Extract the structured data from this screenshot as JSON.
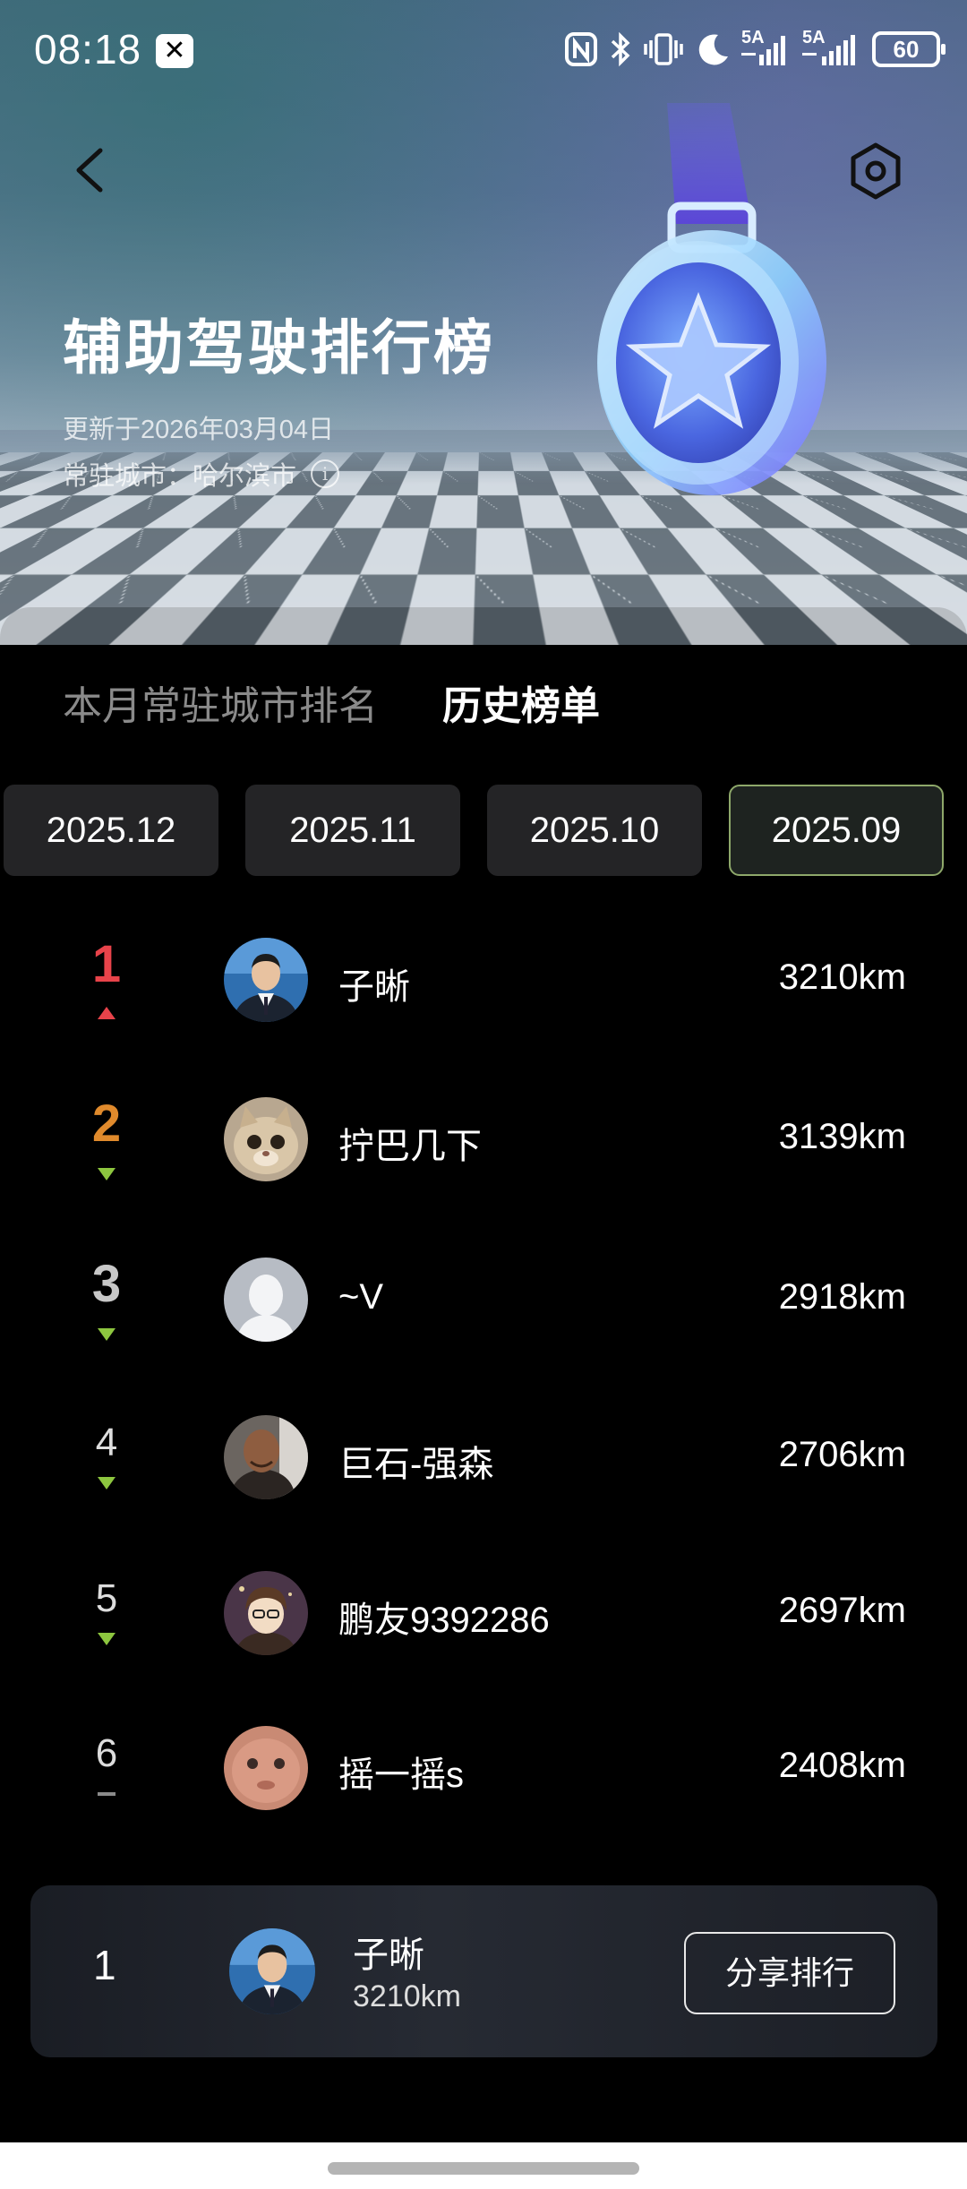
{
  "status_bar": {
    "time": "08:18",
    "app_badge": "✕",
    "signal_label_1": "5A",
    "signal_label_2": "5A",
    "battery": "60",
    "icons": [
      "nfc-icon",
      "bluetooth-icon",
      "vibrate-icon",
      "moon-icon",
      "signal-icon",
      "signal-icon",
      "battery-icon"
    ]
  },
  "header": {
    "title": "辅助驾驶排行榜",
    "updated": "更新于2026年03月04日",
    "city": "常驻城市：哈尔滨市",
    "back_icon": "chevron-left-icon",
    "settings_icon": "hexagon-settings-icon",
    "medal_icon": "star-medal-icon"
  },
  "tabs": [
    {
      "label": "本月常驻城市排名",
      "active": false
    },
    {
      "label": "历史榜单",
      "active": true
    }
  ],
  "months": [
    {
      "label": "2025.12",
      "active": false
    },
    {
      "label": "2025.11",
      "active": false
    },
    {
      "label": "2025.10",
      "active": false
    },
    {
      "label": "2025.09",
      "active": true
    }
  ],
  "colors": {
    "rank1": "#e8434a",
    "rank2": "#e08a2c",
    "rank3": "#c8c8c8",
    "trend_up": "#e8434a",
    "trend_down": "#8dc63f",
    "trend_flat": "#8a8a8a",
    "active_month_border": "#8ea86a"
  },
  "leaderboard": [
    {
      "rank": "1",
      "trend": "up",
      "name": "子晰",
      "distance": "3210km",
      "avatar": "man-in-suit-avatar"
    },
    {
      "rank": "2",
      "trend": "down",
      "name": "拧巴几下",
      "distance": "3139km",
      "avatar": "cat-avatar"
    },
    {
      "rank": "3",
      "trend": "down",
      "name": "~V",
      "distance": "2918km",
      "avatar": "default-avatar"
    },
    {
      "rank": "4",
      "trend": "down",
      "name": "巨石-强森",
      "distance": "2706km",
      "avatar": "bald-man-avatar"
    },
    {
      "rank": "5",
      "trend": "down",
      "name": "鹏友9392286",
      "distance": "2697km",
      "avatar": "cartoon-avatar"
    },
    {
      "rank": "6",
      "trend": "flat",
      "name": "摇一摇s",
      "distance": "2408km",
      "avatar": "round-face-avatar"
    }
  ],
  "my_rank": {
    "rank": "1",
    "name": "子晰",
    "distance": "3210km",
    "share_label": "分享排行"
  }
}
